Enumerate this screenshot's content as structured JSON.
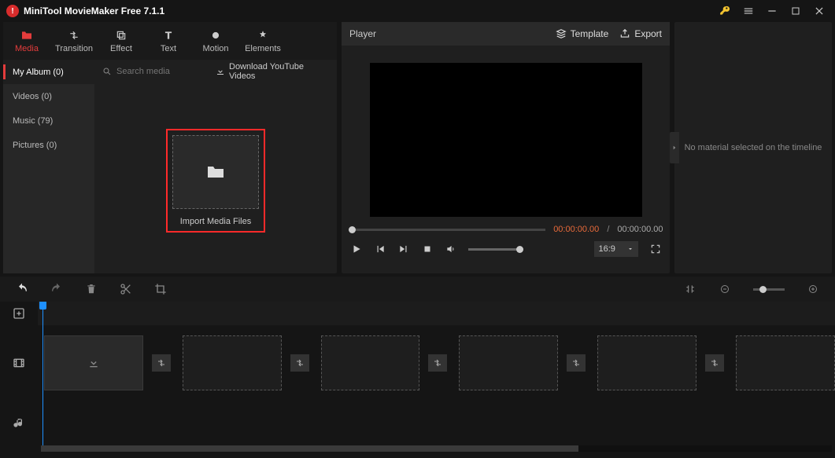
{
  "app": {
    "title": "MiniTool MovieMaker Free 7.1.1"
  },
  "tabs": {
    "media": "Media",
    "transition": "Transition",
    "effect": "Effect",
    "text": "Text",
    "motion": "Motion",
    "elements": "Elements"
  },
  "sidebar": {
    "items": [
      {
        "label": "My Album (0)"
      },
      {
        "label": "Videos (0)"
      },
      {
        "label": "Music (79)"
      },
      {
        "label": "Pictures (0)"
      }
    ]
  },
  "media": {
    "search_placeholder": "Search media",
    "download_label": "Download YouTube Videos",
    "import_label": "Import Media Files"
  },
  "player": {
    "title": "Player",
    "template_label": "Template",
    "export_label": "Export",
    "time_current": "00:00:00.00",
    "time_sep": "/",
    "time_total": "00:00:00.00",
    "aspect": "16:9"
  },
  "properties": {
    "empty_text": "No material selected on the timeline"
  }
}
